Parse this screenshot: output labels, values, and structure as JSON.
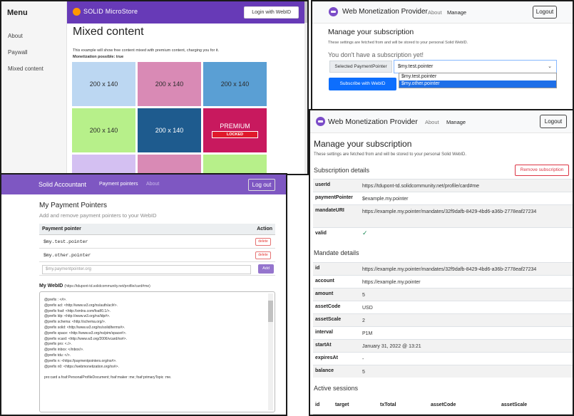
{
  "microstore": {
    "sidebar": {
      "title": "Menu",
      "items": [
        {
          "label": "About"
        },
        {
          "label": "Paywall"
        },
        {
          "label": "Mixed content"
        }
      ]
    },
    "brand": "SOLID MicroStore",
    "login_label": "Login with WebID",
    "page_title": "Mixed content",
    "description": "This example will show free content mixed with premium content, charging you for it.",
    "monetization": "Monetization possible: true",
    "tiles": [
      {
        "label": "200 x 140",
        "color": "#bcd7f2"
      },
      {
        "label": "200 x 140",
        "color": "#d98ab5"
      },
      {
        "label": "200 x 140",
        "color": "#5a9fd4"
      },
      {
        "label": "200 x 140",
        "color": "#b7f08a"
      },
      {
        "label": "200 x 140",
        "color": "#1e5b8e"
      },
      {
        "label": "PREMIUM",
        "color": "#c8195e",
        "locked": "LOCKED"
      },
      {
        "label": "",
        "color": "#d4c0f2"
      },
      {
        "label": "",
        "color": "#d98ab5"
      },
      {
        "label": "",
        "color": "#b7f08a"
      }
    ]
  },
  "provider_top": {
    "brand": "Web Monetization Provider",
    "nav": {
      "about": "About",
      "manage": "Manage"
    },
    "logout_label": "Logout",
    "title": "Manage your subscription",
    "subtitle": "These settings are fetched from and will be stored to your personal Solid WebID.",
    "no_subscription": "You don't have a subscription yet!",
    "select_label": "Selected PaymentPointer",
    "selected_value": "$my.test.pointer",
    "options": [
      "$my.test.pointer",
      "$my.other.pointer"
    ],
    "highlighted_option": 1,
    "subscribe_label": "Subscribe with WebID"
  },
  "accountant": {
    "brand": "Solid Accountant",
    "nav": {
      "payment_pointers": "Payment pointers",
      "about": "About"
    },
    "logout_label": "Log out",
    "title": "My Payment Pointers",
    "subtitle": "Add and remove payment pointers to your WebID",
    "table": {
      "headers": [
        "Payment pointer",
        "Action"
      ],
      "rows": [
        {
          "pointer": "$my.test.pointer",
          "action": "delete"
        },
        {
          "pointer": "$my.other.pointer",
          "action": "delete"
        }
      ],
      "input_placeholder": "$my.paymentpointer.org",
      "add_label": "Add"
    },
    "webid_label": "My WebID",
    "webid_url": "(https://tdupont-td.solidcommunity.net/profile/card#me)",
    "turtle_lines": [
      "@prefix : <#>.",
      "@prefix acl: <http://www.w3.org/ns/auth/acl#>.",
      "@prefix foaf: <http://xmlns.com/foaf/0.1/>.",
      "@prefix ldp: <http://www.w3.org/ns/ldp#>.",
      "@prefix schema: <http://schema.org/>.",
      "@prefix solid: <http://www.w3.org/ns/solid/terms#>.",
      "@prefix space: <http://www.w3.org/ns/pim/space#>.",
      "@prefix vcard: <http://www.w3.org/2006/vcard/ns#>.",
      "@prefix pro: <./>.",
      "@prefix inbox: </inbox/>.",
      "@prefix tdu: </>.",
      "@prefix n: <https://paymentpointers.org/ns#>.",
      "@prefix n0: <https://webmonetization.org/ns#>.",
      "",
      "pro:card a foaf:PersonalProfileDocument; foaf:maker :me; foaf:primaryTopic :me."
    ]
  },
  "provider_details": {
    "brand": "Web Monetization Provider",
    "nav": {
      "about": "About",
      "manage": "Manage"
    },
    "logout_label": "Logout",
    "title": "Manage your subscription",
    "subtitle": "These settings are fetched from and will be stored to your personal Solid WebID.",
    "subscription_heading": "Subscription details",
    "remove_label": "Remove subscription",
    "subscription": [
      {
        "key": "userId",
        "value": "https://tdupont-td.solidcommunity.net/profile/card#me"
      },
      {
        "key": "paymentPointer",
        "value": "$example.my.pointer"
      },
      {
        "key": "mandateURI",
        "value": "https://example.my.pointer/mandates/32f9dafb-8429-4bd6-a36b-2778eaf27234"
      },
      {
        "key": "valid",
        "value": "✓"
      }
    ],
    "mandate_heading": "Mandate details",
    "mandate": [
      {
        "key": "id",
        "value": "https://example.my.pointer/mandates/32f9dafb-8429-4bd6-a36b-2778eaf27234"
      },
      {
        "key": "account",
        "value": "https://example.my.pointer"
      },
      {
        "key": "amount",
        "value": "5"
      },
      {
        "key": "assetCode",
        "value": "USD"
      },
      {
        "key": "assetScale",
        "value": "2"
      },
      {
        "key": "interval",
        "value": "P1M"
      },
      {
        "key": "startAt",
        "value": "January 31, 2022 @ 13:21"
      },
      {
        "key": "expiresAt",
        "value": "-"
      },
      {
        "key": "balance",
        "value": "5"
      }
    ],
    "sessions_heading": "Active sessions",
    "sessions_columns": [
      "id",
      "target",
      "txTotal",
      "assetCode",
      "assetScale"
    ]
  },
  "colors": {
    "microstore_purple": "#673ab7",
    "accountant_purple": "#7e57c2",
    "primary_blue": "#0d6efd",
    "danger_red": "#dc3545"
  }
}
